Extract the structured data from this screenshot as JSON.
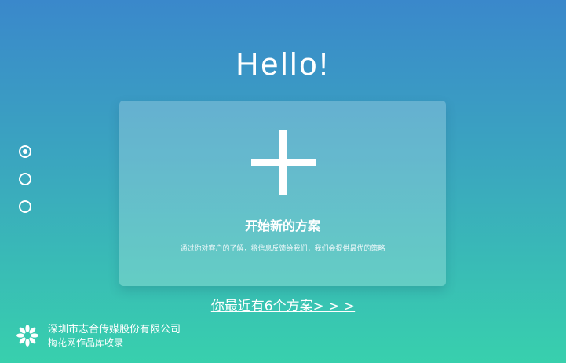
{
  "header": {
    "greeting": "Hello!"
  },
  "new_plan_card": {
    "title": "开始新的方案",
    "description": "通过你对客户的了解，将信息反馈给我们，我们会提供最优的策略",
    "icon": "plus-icon"
  },
  "page_indicator": {
    "count": 3,
    "selected_index": 0
  },
  "recent_plans": {
    "label": "你最近有6个方案> > >"
  },
  "footer": {
    "company": "深圳市志合传媒股份有限公司",
    "collection": "梅花网作品库收录",
    "logo_icon": "flower-logo-icon"
  },
  "colors": {
    "gradient_top": "#3a88cb",
    "gradient_bottom": "#38d0ad",
    "text": "#ffffff"
  }
}
